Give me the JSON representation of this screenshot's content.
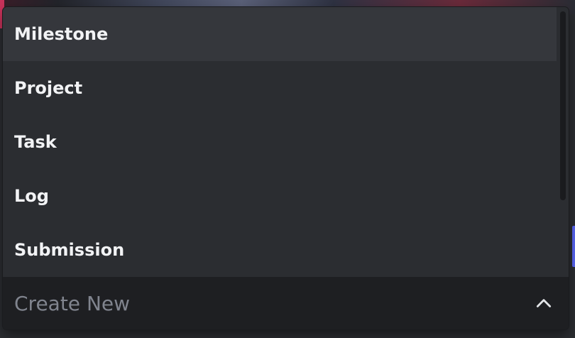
{
  "dropdown": {
    "options": [
      {
        "label": "Milestone"
      },
      {
        "label": "Project"
      },
      {
        "label": "Task"
      },
      {
        "label": "Log"
      },
      {
        "label": "Submission"
      }
    ],
    "placeholder": "Create New",
    "expanded": true,
    "hovered_option": "Milestone"
  },
  "colors": {
    "menu_bg": "#2b2d31",
    "hover_bg": "#35373c",
    "trigger_bg": "#1e1f22",
    "option_text": "#f2f3f5",
    "placeholder_text": "#80848e",
    "accent": "#5865f2"
  },
  "icons": {
    "chevron": "chevron-up-icon"
  }
}
